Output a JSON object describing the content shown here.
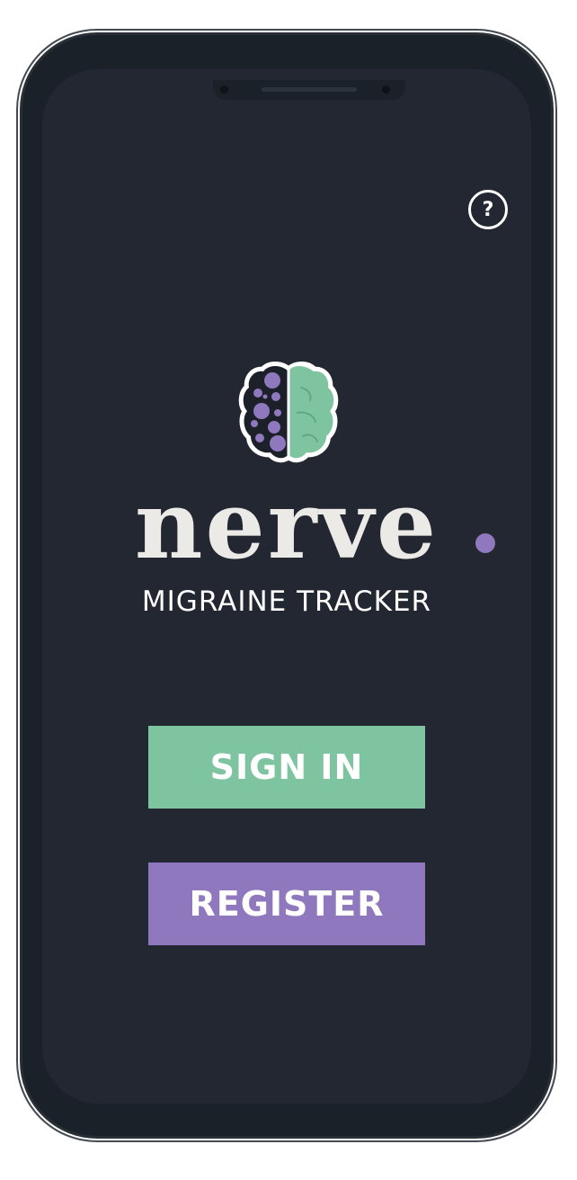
{
  "app": {
    "logo_word": "nerve",
    "tagline": "MIGRAINE TRACKER"
  },
  "header": {
    "help_label": "?",
    "help_icon": "question-circle-icon"
  },
  "actions": {
    "sign_in_label": "SIGN IN",
    "register_label": "REGISTER"
  },
  "icons": {
    "logo": "brain-icon"
  },
  "colors": {
    "background": "#222732",
    "wordmark": "#eceae6",
    "green": "#7fc4a0",
    "purple": "#8f78bd",
    "logo_dark": "#1c2029"
  }
}
